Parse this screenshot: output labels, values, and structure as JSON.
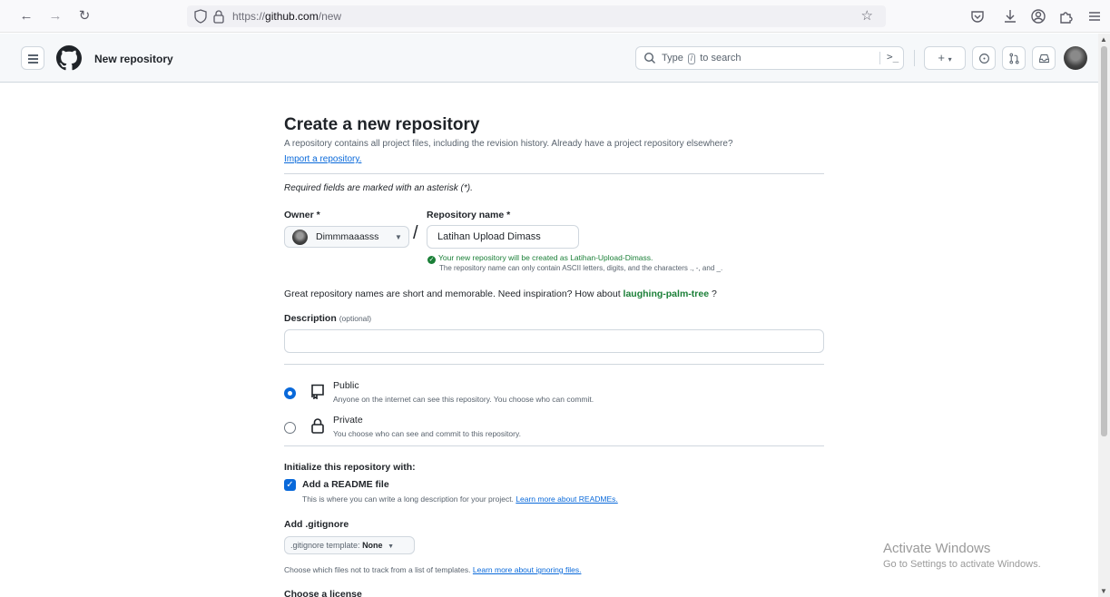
{
  "browser": {
    "url_prefix": "https://",
    "url_domain": "github.com",
    "url_path": "/new"
  },
  "header": {
    "title": "New repository",
    "search_prefix": "Type",
    "search_key": "/",
    "search_suffix": "to search",
    "command_icon": "terminal-icon"
  },
  "page": {
    "title": "Create a new repository",
    "description": "A repository contains all project files, including the revision history. Already have a project repository elsewhere?",
    "import_link": "Import a repository.",
    "required_note": "Required fields are marked with an asterisk (*)."
  },
  "owner": {
    "label": "Owner *",
    "value": "Dimmmaaasss"
  },
  "repository": {
    "label": "Repository name *",
    "value": "Latihan Upload Dimass",
    "valid_message": "Your new repository will be created as Latihan-Upload-Dimass.",
    "rules_message": "The repository name can only contain ASCII letters, digits, and the characters ., -, and _."
  },
  "inspiration": {
    "text": "Great repository names are short and memorable. Need inspiration? How about",
    "suggestion": "laughing-palm-tree",
    "suffix": " ?"
  },
  "description": {
    "label": "Description",
    "optional": "(optional)",
    "value": ""
  },
  "visibility": {
    "selected": "public",
    "options": [
      {
        "title": "Public",
        "description": "Anyone on the internet can see this repository. You choose who can commit."
      },
      {
        "title": "Private",
        "description": "You choose who can see and commit to this repository."
      }
    ]
  },
  "initialize": {
    "label": "Initialize this repository with:",
    "readme_label": "Add a README file",
    "readme_checked": true,
    "readme_desc": "This is where you can write a long description for your project.",
    "readme_link": "Learn more about READMEs."
  },
  "gitignore": {
    "label": "Add .gitignore",
    "template_prefix": ".gitignore template:",
    "template_value": "None",
    "desc": "Choose which files not to track from a list of templates.",
    "link": "Learn more about ignoring files."
  },
  "license": {
    "label": "Choose a license"
  },
  "watermark": {
    "title": "Activate Windows",
    "subtitle": "Go to Settings to activate Windows."
  },
  "colors": {
    "accent": "#0969da",
    "success": "#1a7f37",
    "border": "#d0d7de"
  }
}
